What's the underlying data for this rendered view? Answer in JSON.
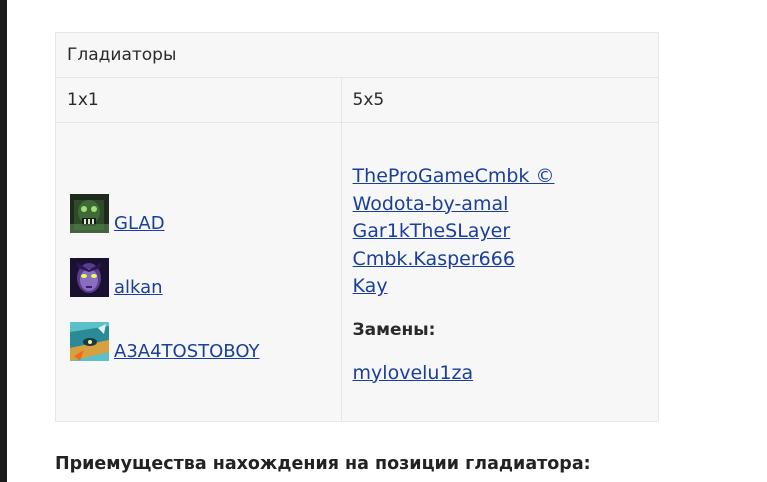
{
  "table": {
    "title": "Гладиаторы",
    "columns": [
      "1x1",
      "5x5"
    ],
    "solo_players": [
      {
        "name": "GLAD",
        "avatar": "glad-avatar-icon"
      },
      {
        "name": "alkan",
        "avatar": "alkan-avatar-icon"
      },
      {
        "name": "A3A4TOSTOBOY",
        "avatar": "a3a4tostoboy-avatar-icon"
      }
    ],
    "team": {
      "players": [
        "TheProGameCmbk ©",
        "Wodota-by-amal",
        "Gar1kTheSLayer",
        "Cmbk.Kasper666",
        "Kay"
      ],
      "subs_label": "Замены:",
      "subs": [
        "mylovelu1za"
      ]
    }
  },
  "section_heading": "Приемущества нахождения на позиции гладиатора:",
  "colors": {
    "link": "#1a3f9a",
    "table_bg": "#f7f7f7",
    "border": "#e6e6e6"
  }
}
